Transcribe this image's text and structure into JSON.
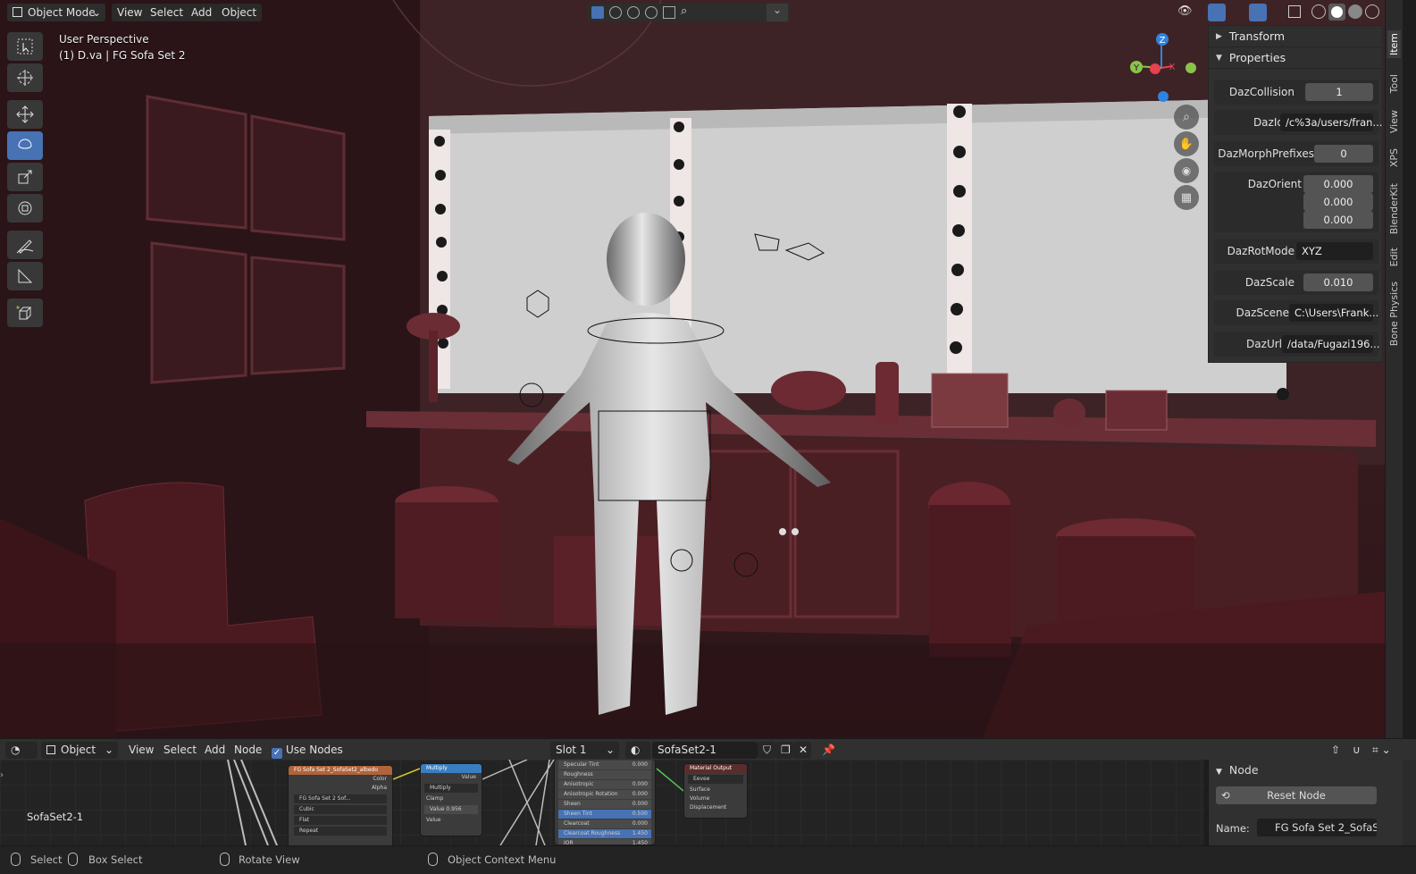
{
  "viewport_header": {
    "mode": "Object Mode",
    "menus": [
      "View",
      "Select",
      "Add",
      "Object"
    ]
  },
  "viewport_info": {
    "perspective": "User Perspective",
    "object": "(1) D.va | FG Sofa Set 2"
  },
  "toolbar": {
    "tools": [
      "select-box",
      "cursor",
      "move",
      "rotate",
      "scale",
      "transform",
      "annotate",
      "measure",
      "add-cube"
    ],
    "active_tool": "rotate"
  },
  "gizmo": {
    "x": "X",
    "y": "Y",
    "z": "Z"
  },
  "nav_buttons": [
    "zoom-icon",
    "hand-icon",
    "camera-icon",
    "grid-icon"
  ],
  "n_panel": {
    "transform": "Transform",
    "properties": "Properties",
    "props": [
      {
        "label": "DazCollision",
        "value": "1",
        "kind": "num"
      },
      {
        "label": "DazId",
        "value": "/c%3a/users/fran...",
        "kind": "txt"
      },
      {
        "label": "DazMorphPrefixes",
        "value": "0",
        "kind": "num"
      },
      {
        "label": "DazOrient",
        "values": [
          "0.000",
          "0.000",
          "0.000"
        ],
        "kind": "vec"
      },
      {
        "label": "DazRotMode",
        "value": "XYZ",
        "kind": "txt"
      },
      {
        "label": "DazScale",
        "value": "0.010",
        "kind": "num"
      },
      {
        "label": "DazScene",
        "value": "C:\\Users\\Frank...",
        "kind": "txt"
      },
      {
        "label": "DazUrl",
        "value": "/data/Fugazi196...",
        "kind": "txt"
      }
    ]
  },
  "side_tabs": [
    "Item",
    "Tool",
    "View",
    "XPS",
    "BlenderKit",
    "Edit",
    "Bone Physics"
  ],
  "editor_header": {
    "type": "Object",
    "menus": [
      "View",
      "Select",
      "Add",
      "Node"
    ],
    "use_nodes": "Use Nodes",
    "slot": "Slot 1",
    "material": "SofaSet2-1"
  },
  "node_editor": {
    "material_label": "SofaSet2-1",
    "image_node": {
      "title": "FG Sofa Set 2_SofaSet2_albedo",
      "outputs": [
        "Color",
        "Alpha"
      ],
      "image": "FG Sofa Set 2 Sof...",
      "options": [
        "Cubic",
        "Flat",
        "Repeat"
      ]
    },
    "math_node": {
      "title": "Multiply",
      "output": "Value",
      "operation": "Multiply",
      "clamp": "Clamp",
      "value_label": "Value",
      "value": "0.956",
      "input": "Value"
    },
    "bsdf_rows": [
      {
        "label": "Specular Tint",
        "value": "0.000"
      },
      {
        "label": "Roughness",
        "value": ""
      },
      {
        "label": "Anisotropic",
        "value": "0.000"
      },
      {
        "label": "Anisotropic Rotation",
        "value": "0.000"
      },
      {
        "label": "Sheen",
        "value": "0.000"
      },
      {
        "label": "Sheen Tint",
        "value": "0.500"
      },
      {
        "label": "Clearcoat",
        "value": "0.000"
      },
      {
        "label": "Clearcoat Roughness",
        "value": "1.450"
      },
      {
        "label": "IOR",
        "value": "1.450"
      }
    ],
    "output_node": {
      "title": "Material Output",
      "target": "Eevee",
      "inputs": [
        "Surface",
        "Volume",
        "Displacement"
      ]
    }
  },
  "node_sidebar": {
    "title": "Node",
    "reset": "Reset Node",
    "name_label": "Name:",
    "name_value": "FG Sofa Set 2_SofaS..."
  },
  "status_bar": {
    "select": "Select",
    "box_select": "Box Select",
    "rotate_view": "Rotate View",
    "context_menu": "Object Context Menu"
  },
  "colors": {
    "accent": "#4772b3",
    "axis_x": "#e8414f",
    "axis_y": "#8bc34a",
    "axis_z": "#2f83e0",
    "scene_red": "#5a1f26"
  }
}
